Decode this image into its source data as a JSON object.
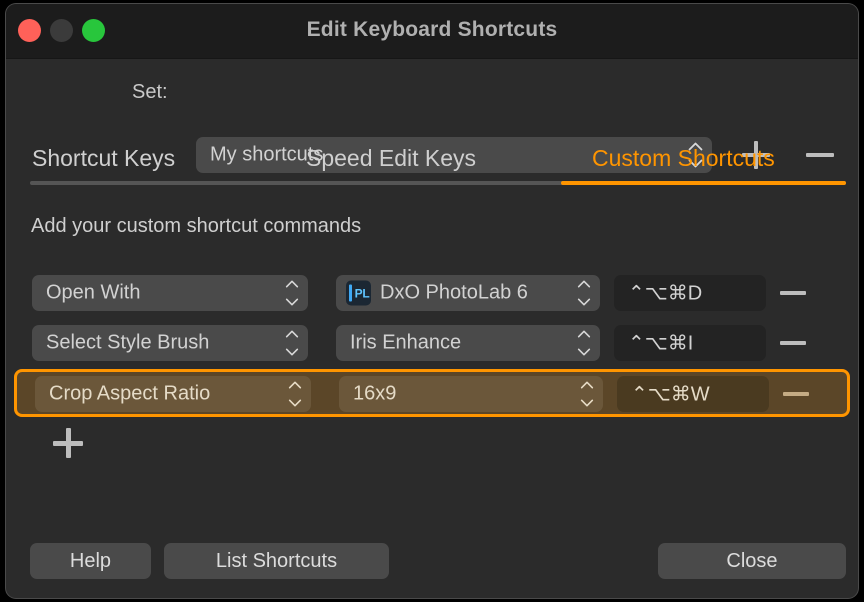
{
  "window": {
    "title": "Edit Keyboard Shortcuts",
    "traffic_lights": [
      {
        "name": "close",
        "color": "#ff6159"
      },
      {
        "name": "minimize",
        "color": "#3b3b3b"
      },
      {
        "name": "zoom",
        "color": "#28c63c"
      }
    ]
  },
  "set_row": {
    "label": "Set:",
    "selected_set": "My shortcuts",
    "add_icon": "plus-icon",
    "remove_icon": "minus-icon"
  },
  "tabs": [
    {
      "label": "Shortcut Keys",
      "active": false
    },
    {
      "label": "Speed Edit Keys",
      "active": false
    },
    {
      "label": "Custom Shortcuts",
      "active": true
    }
  ],
  "description": "Add your custom shortcut commands",
  "shortcuts": [
    {
      "command": "Open With",
      "value": "DxO PhotoLab 6",
      "value_icon": "photolab-app-icon",
      "value_icon_text": "PL",
      "keys": "⌃⌥⌘D",
      "selected": false
    },
    {
      "command": "Select Style Brush",
      "value": "Iris Enhance",
      "value_icon": null,
      "value_icon_text": "",
      "keys": "⌃⌥⌘I",
      "selected": false
    },
    {
      "command": "Crop Aspect Ratio",
      "value": "16x9",
      "value_icon": null,
      "value_icon_text": "",
      "keys": "⌃⌥⌘W",
      "selected": true
    }
  ],
  "add_shortcut_icon": "plus-icon",
  "footer": {
    "help": "Help",
    "list_shortcuts": "List Shortcuts",
    "close": "Close"
  },
  "colors": {
    "accent": "#ff9500",
    "window_bg": "#2b2b2b",
    "titlebar_bg": "#1c1c1c",
    "control_bg": "#4a4a4a",
    "keyfield_bg": "#232323",
    "highlight_row_bg": "#5b4628"
  }
}
